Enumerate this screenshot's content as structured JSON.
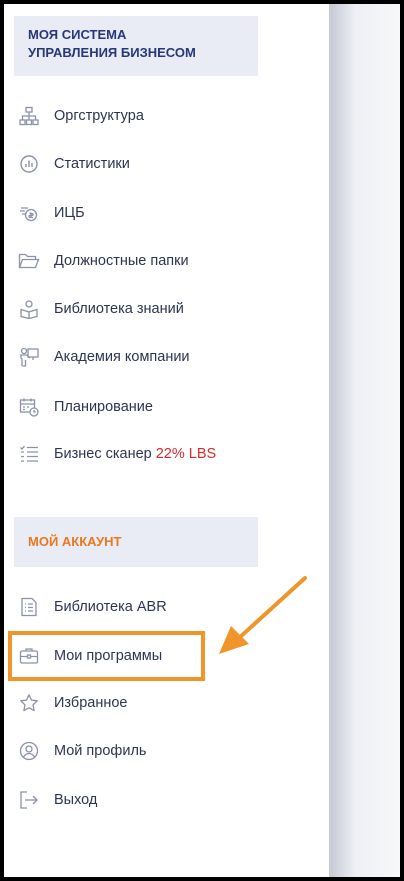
{
  "sections": {
    "business": {
      "title_line1": "МОЯ СИСТЕМА",
      "title_line2": "УПРАВЛЕНИЯ БИЗНЕСОМ"
    },
    "account": {
      "title": "МОЙ АККАУНТ"
    }
  },
  "menu": [
    {
      "label": "Оргструктура",
      "icon": "org-structure-icon"
    },
    {
      "label": "Статистики",
      "icon": "statistics-icon"
    },
    {
      "label": "ИЦБ",
      "icon": "icb-icon"
    },
    {
      "label": "Должностные папки",
      "icon": "folder-icon"
    },
    {
      "label": "Библиотека знаний",
      "icon": "reader-icon"
    },
    {
      "label": "Академия компании",
      "icon": "teacher-icon"
    },
    {
      "label": "Планирование",
      "icon": "calendar-clock-icon"
    },
    {
      "label": "Бизнес сканер",
      "icon": "checklist-icon",
      "badge": "22% LBS"
    }
  ],
  "account_menu": [
    {
      "label": "Библиотека ABR",
      "icon": "document-list-icon"
    },
    {
      "label": "Мои программы",
      "icon": "briefcase-icon"
    },
    {
      "label": "Избранное",
      "icon": "star-icon"
    },
    {
      "label": "Мой профиль",
      "icon": "profile-icon"
    },
    {
      "label": "Выход",
      "icon": "logout-icon"
    }
  ],
  "colors": {
    "header_bg": "#e9ecf5",
    "business_title": "#26387a",
    "account_title": "#e8791e",
    "badge": "#d42b2b",
    "highlight": "#f0952a"
  }
}
